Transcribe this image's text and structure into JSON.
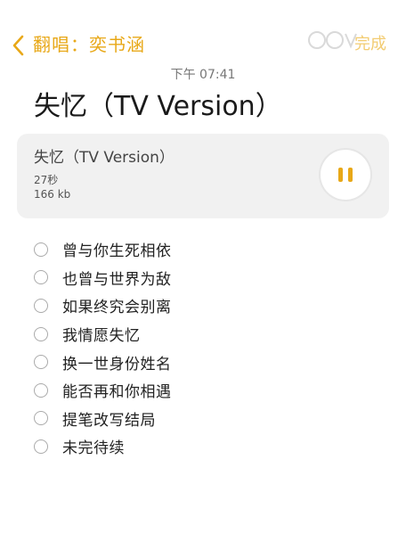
{
  "header": {
    "back_icon": "chevron-left-icon",
    "title": "翻唱：奕书涵",
    "done_label": "完成",
    "accent_color": "#e8a818"
  },
  "timestamp": "下午 07:41",
  "note": {
    "title": "失忆（TV Version）"
  },
  "audio": {
    "name": "失忆（TV Version）",
    "duration": "27秒",
    "size": "166 kb",
    "state_icon": "pause-icon"
  },
  "checklist": [
    {
      "text": "曾与你生死相依",
      "checked": false
    },
    {
      "text": "也曾与世界为敌",
      "checked": false
    },
    {
      "text": "如果终究会别离",
      "checked": false
    },
    {
      "text": "我情愿失忆",
      "checked": false
    },
    {
      "text": "换一世身份姓名",
      "checked": false
    },
    {
      "text": "能否再和你相遇",
      "checked": false
    },
    {
      "text": "提笔改写结局",
      "checked": false
    },
    {
      "text": "未完待续",
      "checked": false
    }
  ]
}
